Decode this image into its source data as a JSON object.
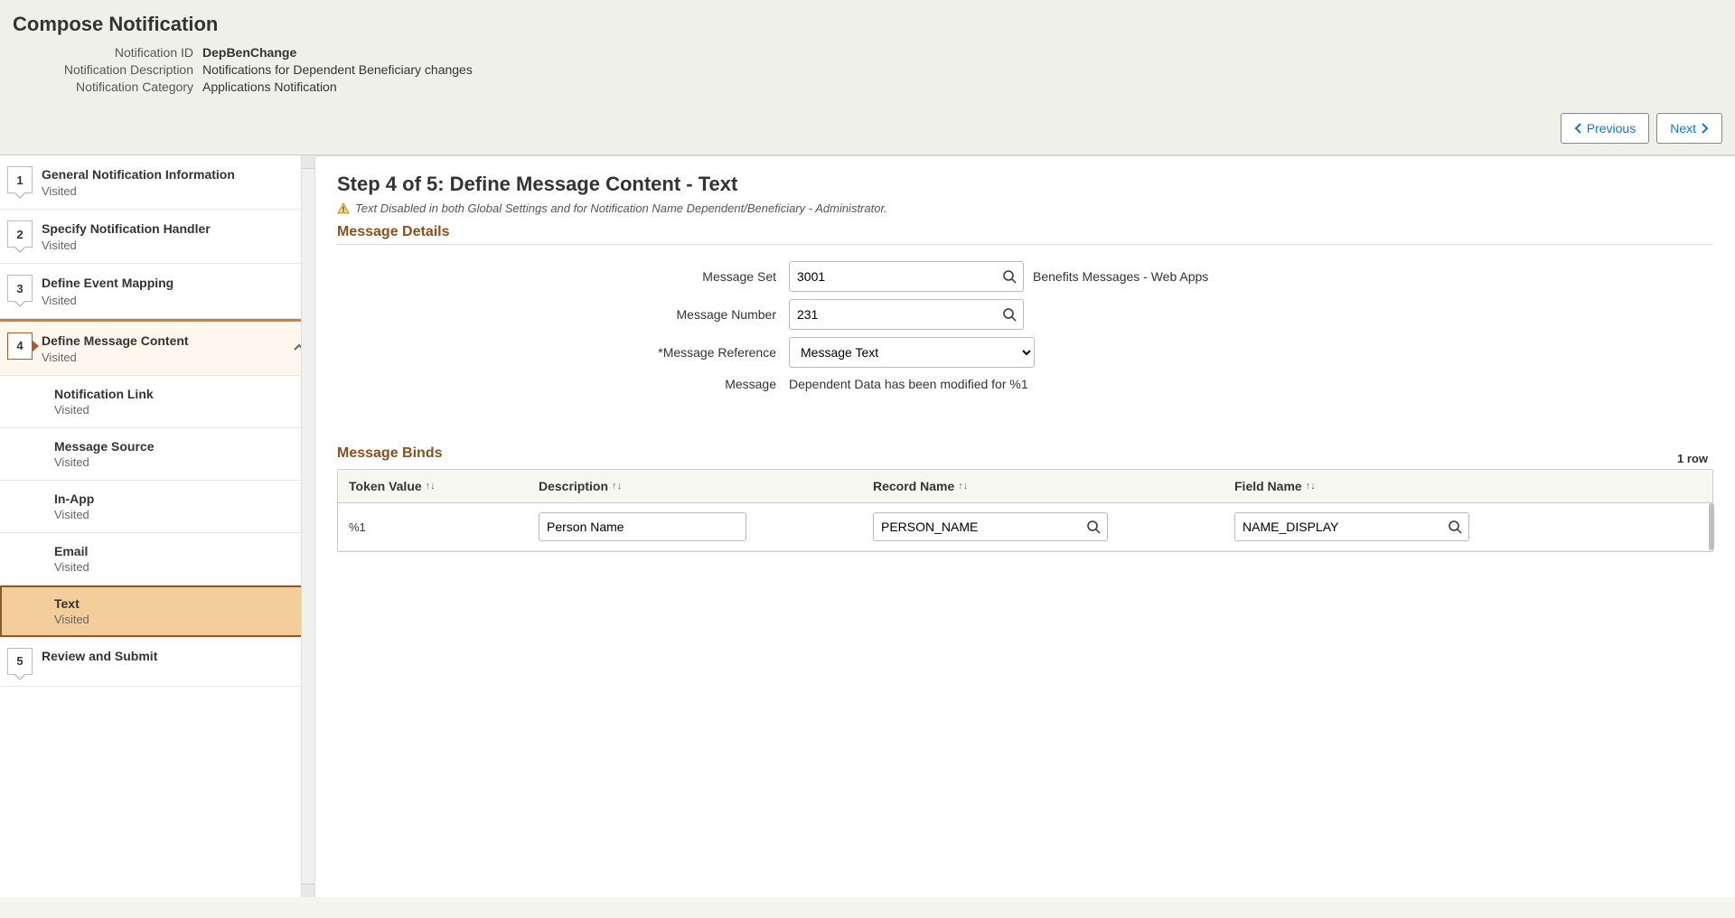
{
  "page": {
    "title": "Compose Notification",
    "labels": {
      "id": "Notification ID",
      "desc": "Notification Description",
      "cat": "Notification Category"
    },
    "values": {
      "id": "DepBenChange",
      "desc": "Notifications for Dependent Beneficiary changes",
      "cat": "Applications Notification"
    },
    "nav": {
      "prev": "Previous",
      "next": "Next"
    }
  },
  "sidebar": {
    "items": [
      {
        "num": "1",
        "title": "General Notification Information",
        "status": "Visited"
      },
      {
        "num": "2",
        "title": "Specify Notification Handler",
        "status": "Visited"
      },
      {
        "num": "3",
        "title": "Define Event Mapping",
        "status": "Visited"
      },
      {
        "num": "4",
        "title": "Define Message Content",
        "status": "Visited"
      },
      {
        "num": "5",
        "title": "Review and Submit",
        "status": ""
      }
    ],
    "subitems": [
      {
        "title": "Notification Link",
        "status": "Visited"
      },
      {
        "title": "Message Source",
        "status": "Visited"
      },
      {
        "title": "In-App",
        "status": "Visited"
      },
      {
        "title": "Email",
        "status": "Visited"
      },
      {
        "title": "Text",
        "status": "Visited"
      }
    ]
  },
  "main": {
    "step_title": "Step 4 of 5: Define Message Content - Text",
    "warning": "Text Disabled in both Global Settings and for Notification Name Dependent/Beneficiary - Administrator.",
    "section_details": "Message Details",
    "section_binds": "Message Binds",
    "labels": {
      "set": "Message Set",
      "number": "Message Number",
      "reference": "*Message Reference",
      "message": "Message"
    },
    "values": {
      "set": "3001",
      "set_desc": "Benefits Messages - Web Apps",
      "number": "231",
      "reference": "Message Text",
      "message": "Dependent Data has been modified for %1"
    },
    "binds": {
      "rowcount": "1 row",
      "headers": {
        "token": "Token Value",
        "desc": "Description",
        "record": "Record Name",
        "field": "Field Name"
      },
      "rows": [
        {
          "token": "%1",
          "desc": "Person Name",
          "record": "PERSON_NAME",
          "field": "NAME_DISPLAY"
        }
      ]
    }
  }
}
